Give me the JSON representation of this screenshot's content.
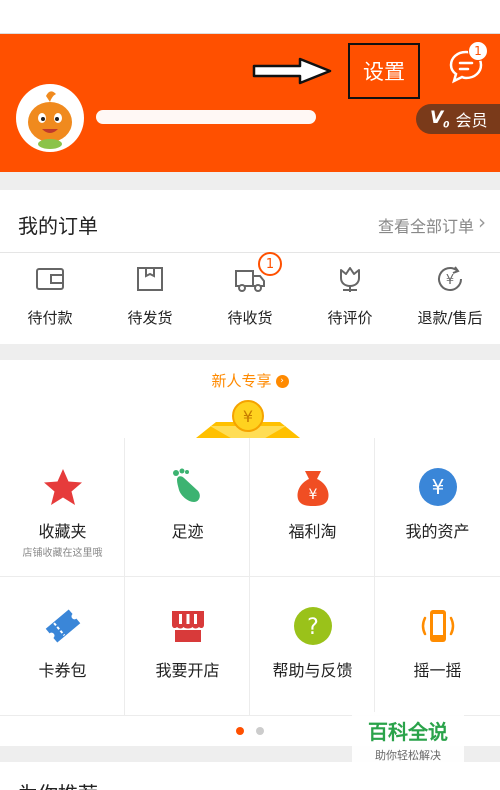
{
  "header": {
    "settings_label": "设置",
    "message_badge": "1",
    "vip_label": "会员",
    "vip_level": "V",
    "vip_sub": "0"
  },
  "orders": {
    "title": "我的订单",
    "view_all": "查看全部订单",
    "items": [
      {
        "label": "待付款",
        "icon": "wallet-icon"
      },
      {
        "label": "待发货",
        "icon": "package-icon"
      },
      {
        "label": "待收货",
        "icon": "truck-icon",
        "badge": "1"
      },
      {
        "label": "待评价",
        "icon": "tulip-icon"
      },
      {
        "label": "退款/售后",
        "icon": "refund-icon"
      }
    ]
  },
  "newbie": {
    "title": "新人专享",
    "coin": "¥"
  },
  "services": [
    {
      "label": "收藏夹",
      "sub": "店铺收藏在这里哦",
      "icon": "star-icon",
      "color": "#e63b3b"
    },
    {
      "label": "足迹",
      "sub": "",
      "icon": "footprint-icon",
      "color": "#3cb371"
    },
    {
      "label": "福利淘",
      "sub": "",
      "icon": "money-bag-icon",
      "color": "#f04e23"
    },
    {
      "label": "我的资产",
      "sub": "",
      "icon": "yuan-coin-icon",
      "color": "#3a86d8"
    },
    {
      "label": "卡券包",
      "sub": "",
      "icon": "ticket-icon",
      "color": "#3a86d8"
    },
    {
      "label": "我要开店",
      "sub": "",
      "icon": "shop-icon",
      "color": "#d83a3a"
    },
    {
      "label": "帮助与反馈",
      "sub": "",
      "icon": "help-icon",
      "color": "#9ac21a"
    },
    {
      "label": "摇一摇",
      "sub": "",
      "icon": "shake-phone-icon",
      "color": "#ff8c00"
    }
  ],
  "pager": {
    "active": 0,
    "count": 2
  },
  "recommend": {
    "title": "为你推荐"
  },
  "watermark": {
    "main": "百科全说",
    "sub": "助你轻松解决"
  },
  "colors": {
    "brand": "#ff5000",
    "vip_bg": "#7a3a1a"
  }
}
